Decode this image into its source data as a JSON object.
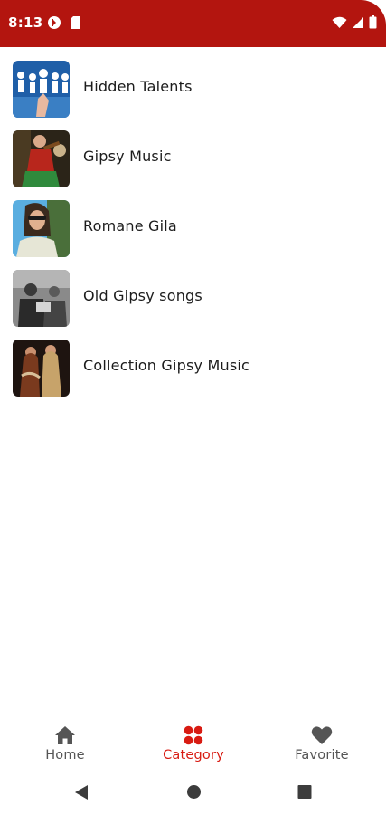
{
  "status_bar": {
    "time": "8:13",
    "background": "#b3150f",
    "left_icons": [
      "data-saver-icon",
      "sd-card-icon"
    ],
    "right_icons": [
      "wifi-icon",
      "signal-icon",
      "battery-icon"
    ]
  },
  "categories": [
    {
      "label": "Hidden Talents",
      "thumb_icon": "paper-people-thumbnail"
    },
    {
      "label": "Gipsy Music",
      "thumb_icon": "violinist-thumbnail"
    },
    {
      "label": "Romane Gila",
      "thumb_icon": "woman-sunglasses-thumbnail"
    },
    {
      "label": "Old Gipsy songs",
      "thumb_icon": "old-photo-thumbnail"
    },
    {
      "label": "Collection Gipsy Music",
      "thumb_icon": "dancers-thumbnail"
    }
  ],
  "bottom_nav": {
    "active_color": "#d81b12",
    "inactive_color": "#555555",
    "items": [
      {
        "label": "Home",
        "icon": "home-icon",
        "active": false
      },
      {
        "label": "Category",
        "icon": "category-icon",
        "active": true
      },
      {
        "label": "Favorite",
        "icon": "heart-icon",
        "active": false
      }
    ]
  },
  "system_nav": {
    "buttons": [
      "back-icon",
      "home-circle-icon",
      "recents-square-icon"
    ]
  }
}
